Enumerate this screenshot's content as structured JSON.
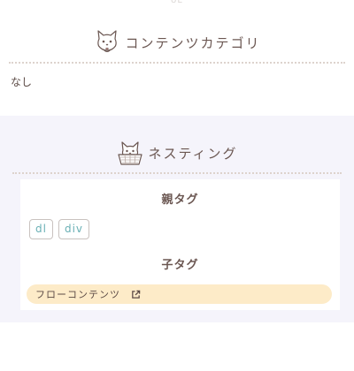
{
  "top_stub_text": "UE",
  "categories": {
    "title": "コンテンツカテゴリ",
    "value": "なし"
  },
  "nesting": {
    "title": "ネスティング",
    "parent": {
      "title": "親タグ",
      "tags": [
        "dl",
        "div"
      ]
    },
    "child": {
      "title": "子タグ",
      "link_label": "フローコンテンツ"
    }
  },
  "colors": {
    "panel_bg": "#f5f4fb",
    "tag_text": "#6ab0b5",
    "pill_bg": "#fdebc8",
    "heading_text": "#6b5752"
  },
  "icons": {
    "category_icon": "cat-face-icon",
    "nesting_icon": "cat-in-basket-icon",
    "link_icon": "external-link-icon"
  }
}
